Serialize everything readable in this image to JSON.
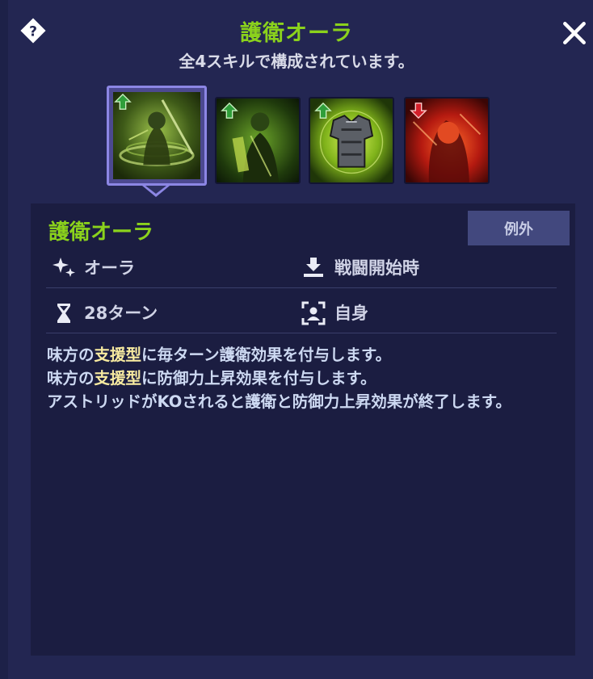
{
  "header": {
    "title": "護衛オーラ",
    "subtitle": "全4スキルで構成されています。"
  },
  "skills": [
    {
      "icon": "guardian-aura-skill-icon",
      "type": "buff",
      "selected": true
    },
    {
      "icon": "knight-skill-icon",
      "type": "buff",
      "selected": false
    },
    {
      "icon": "armor-skill-icon",
      "type": "buff",
      "selected": false
    },
    {
      "icon": "red-warrior-skill-icon",
      "type": "debuff",
      "selected": false
    }
  ],
  "detail": {
    "title": "護衛オーラ",
    "tag": "例外",
    "attributes": {
      "category": "オーラ",
      "trigger": "戦闘開始時",
      "duration": "28ターン",
      "target": "自身"
    },
    "description": [
      {
        "pre": "味方の",
        "highlight": "支援型",
        "post": "に毎ターン護衛効果を付与します。"
      },
      {
        "pre": "味方の",
        "highlight": "支援型",
        "post": "に防御力上昇効果を付与します。"
      },
      {
        "pre": "アストリッドがKOされると護衛と防御力上昇効果が終了します。",
        "highlight": "",
        "post": ""
      }
    ]
  },
  "colors": {
    "accent_green": "#8bd21c",
    "highlight_yellow": "#f7eaa0",
    "panel": "#232652",
    "detail_bg": "#1b1d41",
    "buff_arrow": "#2f9e3a",
    "debuff_arrow": "#d4202a"
  }
}
